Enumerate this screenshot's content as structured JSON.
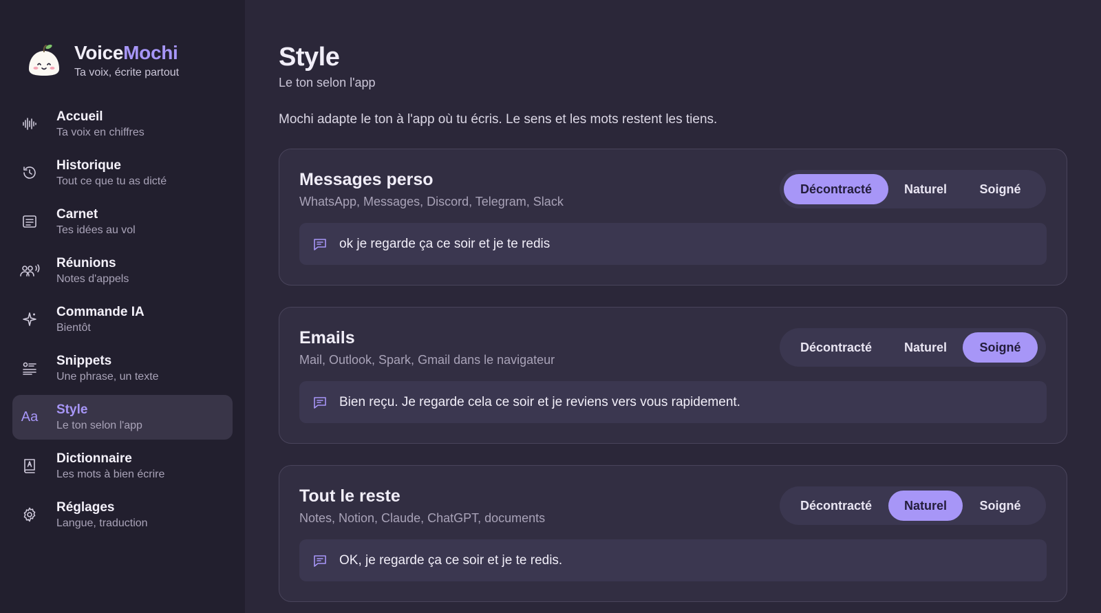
{
  "brand": {
    "name_part1": "Voice",
    "name_part2": "Mochi",
    "tagline": "Ta voix, écrite partout"
  },
  "nav": [
    {
      "title": "Accueil",
      "sub": "Ta voix en chiffres",
      "icon": "waveform-icon"
    },
    {
      "title": "Historique",
      "sub": "Tout ce que tu as dicté",
      "icon": "history-icon"
    },
    {
      "title": "Carnet",
      "sub": "Tes idées au vol",
      "icon": "notebook-icon"
    },
    {
      "title": "Réunions",
      "sub": "Notes d'appels",
      "icon": "people-icon"
    },
    {
      "title": "Commande IA",
      "sub": "Bientôt",
      "icon": "sparkle-icon"
    },
    {
      "title": "Snippets",
      "sub": "Une phrase, un texte",
      "icon": "snippets-icon"
    },
    {
      "title": "Style",
      "sub": "Le ton selon l'app",
      "icon": "text-style-icon",
      "icon_text": "Aa",
      "active": true
    },
    {
      "title": "Dictionnaire",
      "sub": "Les mots à bien écrire",
      "icon": "dictionary-icon"
    },
    {
      "title": "Réglages",
      "sub": "Langue, traduction",
      "icon": "gear-icon"
    }
  ],
  "page": {
    "title": "Style",
    "subtitle": "Le ton selon l'app",
    "description": "Mochi adapte le ton à l'app où tu écris. Le sens et les mots restent les tiens."
  },
  "tone_options": [
    "Décontracté",
    "Naturel",
    "Soigné"
  ],
  "cards": [
    {
      "title": "Messages perso",
      "apps": "WhatsApp, Messages, Discord, Telegram, Slack",
      "selected": "Décontracté",
      "preview": "ok je regarde ça ce soir et je te redis"
    },
    {
      "title": "Emails",
      "apps": "Mail, Outlook, Spark, Gmail dans le navigateur",
      "selected": "Soigné",
      "preview": "Bien reçu. Je regarde cela ce soir et je reviens vers vous rapidement."
    },
    {
      "title": "Tout le reste",
      "apps": "Notes, Notion, Claude, ChatGPT, documents",
      "selected": "Naturel",
      "preview": "OK, je regarde ça ce soir et je te redis."
    }
  ],
  "colors": {
    "accent": "#a796f7",
    "background": "#2b2739",
    "sidebar": "#221f2e",
    "card": "#322e42"
  }
}
